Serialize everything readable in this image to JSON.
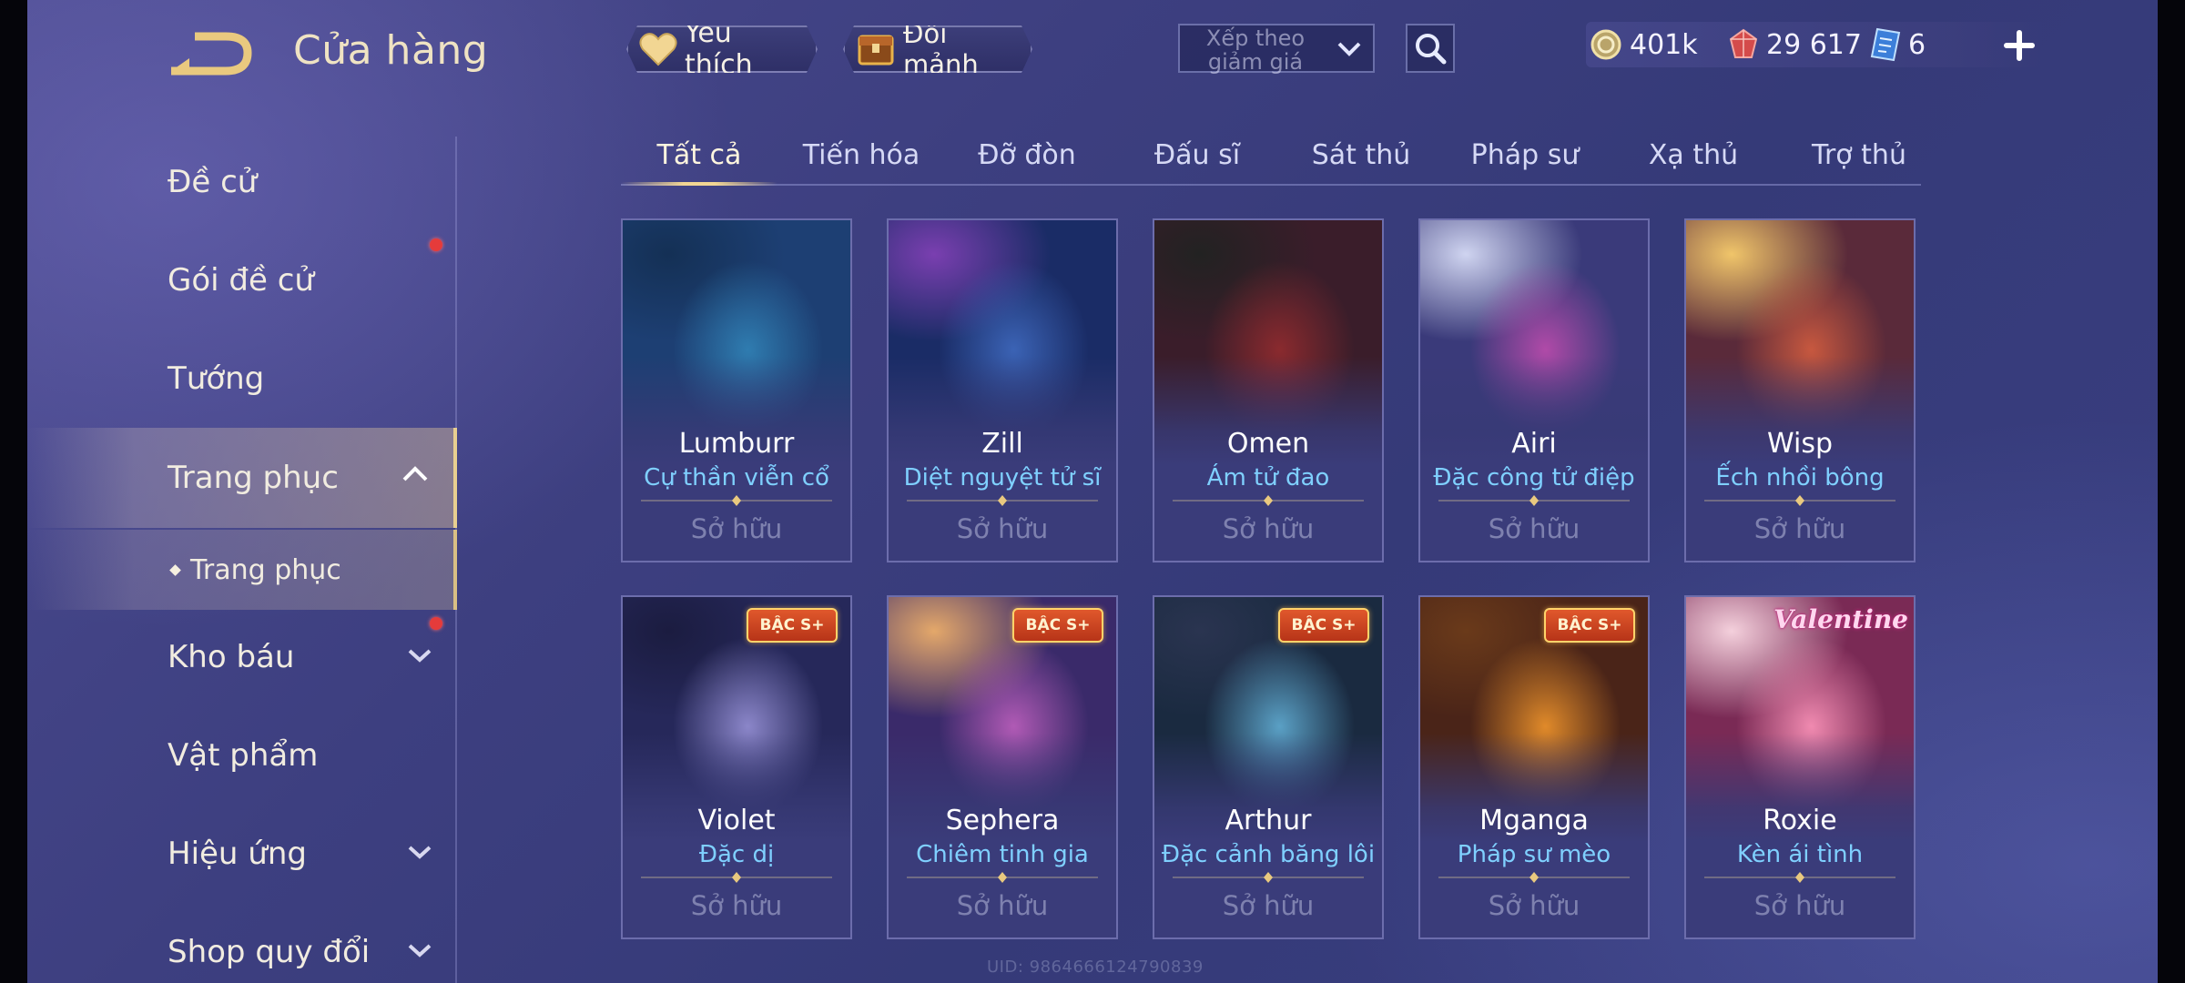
{
  "header": {
    "title": "Cửa hàng",
    "favorites_label": "Yêu thích",
    "trade_label": "Đổi mảnh",
    "sort_label": "Xếp theo giảm giá"
  },
  "currencies": {
    "gold": "401k",
    "rubies": "29 617",
    "vouchers": "6"
  },
  "sidebar": {
    "items": [
      {
        "label": "Đề cử"
      },
      {
        "label": "Gói đề cử"
      },
      {
        "label": "Tướng"
      },
      {
        "label": "Trang phục"
      },
      {
        "label": "Trang phục"
      },
      {
        "label": "Kho báu"
      },
      {
        "label": "Vật phẩm"
      },
      {
        "label": "Hiệu ứng"
      },
      {
        "label": "Shop quy đổi"
      }
    ]
  },
  "tabs": [
    {
      "label": "Tất cả"
    },
    {
      "label": "Tiến hóa"
    },
    {
      "label": "Đỡ đòn"
    },
    {
      "label": "Đấu sĩ"
    },
    {
      "label": "Sát thủ"
    },
    {
      "label": "Pháp sư"
    },
    {
      "label": "Xạ thủ"
    },
    {
      "label": "Trợ thủ"
    }
  ],
  "cards": [
    {
      "hero": "Lumburr",
      "skin": "Cự thần viễn cổ",
      "status": "Sở hữu",
      "art": [
        "#1d3f73",
        "#2f7cb0",
        "#143055"
      ]
    },
    {
      "hero": "Zill",
      "skin": "Diệt nguyệt tử sĩ",
      "status": "Sở hữu",
      "art": [
        "#1a2c66",
        "#3b63b5",
        "#7a3fb0"
      ]
    },
    {
      "hero": "Omen",
      "skin": "Ám tử đao",
      "status": "Sở hữu",
      "art": [
        "#3a1d2a",
        "#8a2a2e",
        "#222"
      ]
    },
    {
      "hero": "Airi",
      "skin": "Đặc công tử điệp",
      "status": "Sở hữu",
      "art": [
        "#3a3a7a",
        "#b04aa8",
        "#cfd4f0"
      ]
    },
    {
      "hero": "Wisp",
      "skin": "Ếch nhồi bông",
      "status": "Sở hữu",
      "art": [
        "#5a2a3a",
        "#c7583f",
        "#f0c56a"
      ]
    },
    {
      "hero": "Violet",
      "skin": "Đặc dị",
      "status": "Sở hữu",
      "badge": "BẬC S+",
      "art": [
        "#26285a",
        "#8b86c9",
        "#1b1c40"
      ]
    },
    {
      "hero": "Sephera",
      "skin": "Chiêm tinh gia",
      "status": "Sở hữu",
      "badge": "BẬC S+",
      "art": [
        "#3a2a6a",
        "#b05ab5",
        "#e4a86a"
      ]
    },
    {
      "hero": "Arthur",
      "skin": "Đặc cảnh băng lôi",
      "status": "Sở hữu",
      "badge": "BẬC S+",
      "art": [
        "#1a2a40",
        "#5aa0c5",
        "#2a3450"
      ]
    },
    {
      "hero": "Mganga",
      "skin": "Pháp sư mèo",
      "status": "Sở hữu",
      "badge": "BẬC S+",
      "art": [
        "#4a2418",
        "#e08a2a",
        "#6a3a1a"
      ]
    },
    {
      "hero": "Roxie",
      "skin": "Kèn ái tình",
      "status": "Sở hữu",
      "event": "Valentine",
      "art": [
        "#7a2a55",
        "#f08ab0",
        "#f4d0dc"
      ]
    }
  ],
  "uid_text": "UID: 9864666124790839",
  "colors": {
    "accent_gold": "#f2d693",
    "skin_name_blue": "#7fd0ff",
    "notification_red": "#e53b3b",
    "badge_orange": "#d24a24"
  }
}
